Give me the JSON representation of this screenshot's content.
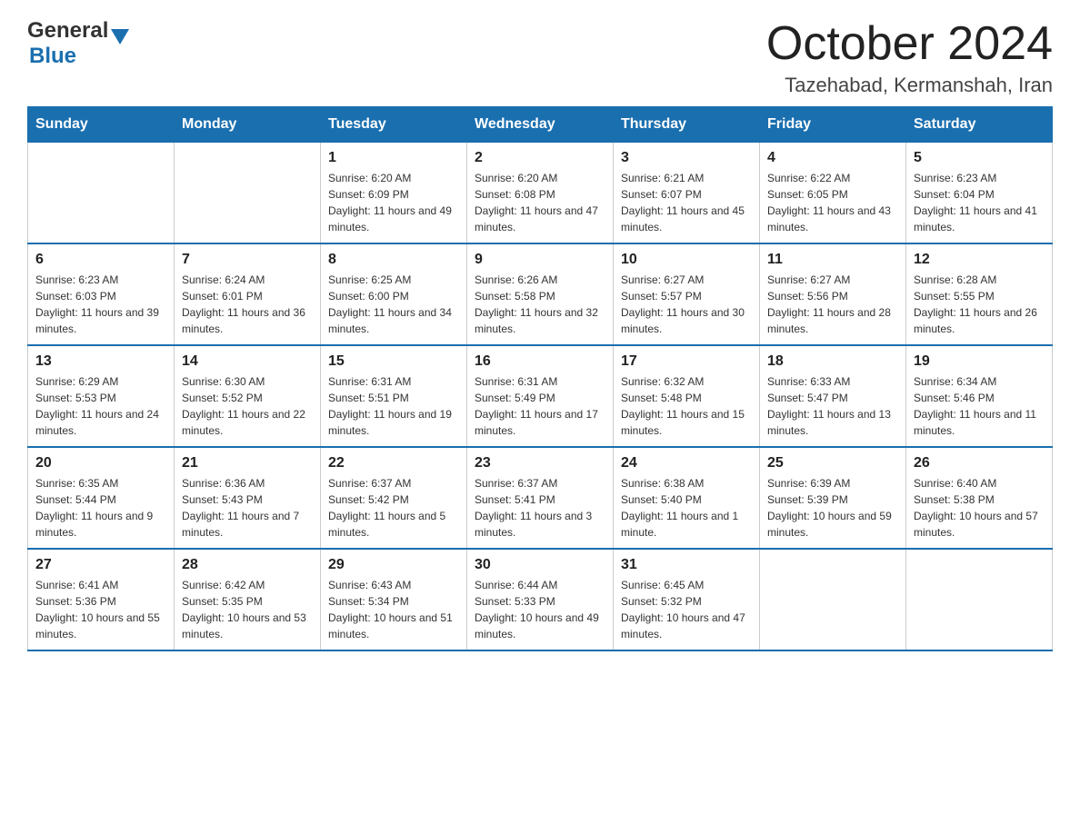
{
  "logo": {
    "general": "General",
    "blue": "Blue"
  },
  "title": {
    "month_year": "October 2024",
    "location": "Tazehabad, Kermanshah, Iran"
  },
  "headers": [
    "Sunday",
    "Monday",
    "Tuesday",
    "Wednesday",
    "Thursday",
    "Friday",
    "Saturday"
  ],
  "weeks": [
    [
      {
        "day": "",
        "sunrise": "",
        "sunset": "",
        "daylight": ""
      },
      {
        "day": "",
        "sunrise": "",
        "sunset": "",
        "daylight": ""
      },
      {
        "day": "1",
        "sunrise": "Sunrise: 6:20 AM",
        "sunset": "Sunset: 6:09 PM",
        "daylight": "Daylight: 11 hours and 49 minutes."
      },
      {
        "day": "2",
        "sunrise": "Sunrise: 6:20 AM",
        "sunset": "Sunset: 6:08 PM",
        "daylight": "Daylight: 11 hours and 47 minutes."
      },
      {
        "day": "3",
        "sunrise": "Sunrise: 6:21 AM",
        "sunset": "Sunset: 6:07 PM",
        "daylight": "Daylight: 11 hours and 45 minutes."
      },
      {
        "day": "4",
        "sunrise": "Sunrise: 6:22 AM",
        "sunset": "Sunset: 6:05 PM",
        "daylight": "Daylight: 11 hours and 43 minutes."
      },
      {
        "day": "5",
        "sunrise": "Sunrise: 6:23 AM",
        "sunset": "Sunset: 6:04 PM",
        "daylight": "Daylight: 11 hours and 41 minutes."
      }
    ],
    [
      {
        "day": "6",
        "sunrise": "Sunrise: 6:23 AM",
        "sunset": "Sunset: 6:03 PM",
        "daylight": "Daylight: 11 hours and 39 minutes."
      },
      {
        "day": "7",
        "sunrise": "Sunrise: 6:24 AM",
        "sunset": "Sunset: 6:01 PM",
        "daylight": "Daylight: 11 hours and 36 minutes."
      },
      {
        "day": "8",
        "sunrise": "Sunrise: 6:25 AM",
        "sunset": "Sunset: 6:00 PM",
        "daylight": "Daylight: 11 hours and 34 minutes."
      },
      {
        "day": "9",
        "sunrise": "Sunrise: 6:26 AM",
        "sunset": "Sunset: 5:58 PM",
        "daylight": "Daylight: 11 hours and 32 minutes."
      },
      {
        "day": "10",
        "sunrise": "Sunrise: 6:27 AM",
        "sunset": "Sunset: 5:57 PM",
        "daylight": "Daylight: 11 hours and 30 minutes."
      },
      {
        "day": "11",
        "sunrise": "Sunrise: 6:27 AM",
        "sunset": "Sunset: 5:56 PM",
        "daylight": "Daylight: 11 hours and 28 minutes."
      },
      {
        "day": "12",
        "sunrise": "Sunrise: 6:28 AM",
        "sunset": "Sunset: 5:55 PM",
        "daylight": "Daylight: 11 hours and 26 minutes."
      }
    ],
    [
      {
        "day": "13",
        "sunrise": "Sunrise: 6:29 AM",
        "sunset": "Sunset: 5:53 PM",
        "daylight": "Daylight: 11 hours and 24 minutes."
      },
      {
        "day": "14",
        "sunrise": "Sunrise: 6:30 AM",
        "sunset": "Sunset: 5:52 PM",
        "daylight": "Daylight: 11 hours and 22 minutes."
      },
      {
        "day": "15",
        "sunrise": "Sunrise: 6:31 AM",
        "sunset": "Sunset: 5:51 PM",
        "daylight": "Daylight: 11 hours and 19 minutes."
      },
      {
        "day": "16",
        "sunrise": "Sunrise: 6:31 AM",
        "sunset": "Sunset: 5:49 PM",
        "daylight": "Daylight: 11 hours and 17 minutes."
      },
      {
        "day": "17",
        "sunrise": "Sunrise: 6:32 AM",
        "sunset": "Sunset: 5:48 PM",
        "daylight": "Daylight: 11 hours and 15 minutes."
      },
      {
        "day": "18",
        "sunrise": "Sunrise: 6:33 AM",
        "sunset": "Sunset: 5:47 PM",
        "daylight": "Daylight: 11 hours and 13 minutes."
      },
      {
        "day": "19",
        "sunrise": "Sunrise: 6:34 AM",
        "sunset": "Sunset: 5:46 PM",
        "daylight": "Daylight: 11 hours and 11 minutes."
      }
    ],
    [
      {
        "day": "20",
        "sunrise": "Sunrise: 6:35 AM",
        "sunset": "Sunset: 5:44 PM",
        "daylight": "Daylight: 11 hours and 9 minutes."
      },
      {
        "day": "21",
        "sunrise": "Sunrise: 6:36 AM",
        "sunset": "Sunset: 5:43 PM",
        "daylight": "Daylight: 11 hours and 7 minutes."
      },
      {
        "day": "22",
        "sunrise": "Sunrise: 6:37 AM",
        "sunset": "Sunset: 5:42 PM",
        "daylight": "Daylight: 11 hours and 5 minutes."
      },
      {
        "day": "23",
        "sunrise": "Sunrise: 6:37 AM",
        "sunset": "Sunset: 5:41 PM",
        "daylight": "Daylight: 11 hours and 3 minutes."
      },
      {
        "day": "24",
        "sunrise": "Sunrise: 6:38 AM",
        "sunset": "Sunset: 5:40 PM",
        "daylight": "Daylight: 11 hours and 1 minute."
      },
      {
        "day": "25",
        "sunrise": "Sunrise: 6:39 AM",
        "sunset": "Sunset: 5:39 PM",
        "daylight": "Daylight: 10 hours and 59 minutes."
      },
      {
        "day": "26",
        "sunrise": "Sunrise: 6:40 AM",
        "sunset": "Sunset: 5:38 PM",
        "daylight": "Daylight: 10 hours and 57 minutes."
      }
    ],
    [
      {
        "day": "27",
        "sunrise": "Sunrise: 6:41 AM",
        "sunset": "Sunset: 5:36 PM",
        "daylight": "Daylight: 10 hours and 55 minutes."
      },
      {
        "day": "28",
        "sunrise": "Sunrise: 6:42 AM",
        "sunset": "Sunset: 5:35 PM",
        "daylight": "Daylight: 10 hours and 53 minutes."
      },
      {
        "day": "29",
        "sunrise": "Sunrise: 6:43 AM",
        "sunset": "Sunset: 5:34 PM",
        "daylight": "Daylight: 10 hours and 51 minutes."
      },
      {
        "day": "30",
        "sunrise": "Sunrise: 6:44 AM",
        "sunset": "Sunset: 5:33 PM",
        "daylight": "Daylight: 10 hours and 49 minutes."
      },
      {
        "day": "31",
        "sunrise": "Sunrise: 6:45 AM",
        "sunset": "Sunset: 5:32 PM",
        "daylight": "Daylight: 10 hours and 47 minutes."
      },
      {
        "day": "",
        "sunrise": "",
        "sunset": "",
        "daylight": ""
      },
      {
        "day": "",
        "sunrise": "",
        "sunset": "",
        "daylight": ""
      }
    ]
  ]
}
